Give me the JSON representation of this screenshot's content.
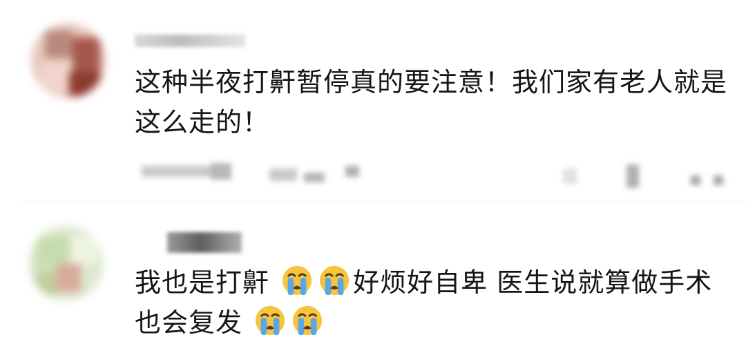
{
  "comments": [
    {
      "text": "这种半夜打鼾暂停真的要注意！我们家有老人就是这么走的！"
    },
    {
      "text_part1": "我也是打鼾",
      "text_part2": "好烦好自卑 医生说就算做手术也会复发",
      "emoji_icon": "loudly-crying-face-icon"
    }
  ],
  "colors": {
    "text": "#151515",
    "emoji_face": "#F7C43D",
    "emoji_tears": "#5AA7E6",
    "blur_gray": "#c9c9c9"
  }
}
